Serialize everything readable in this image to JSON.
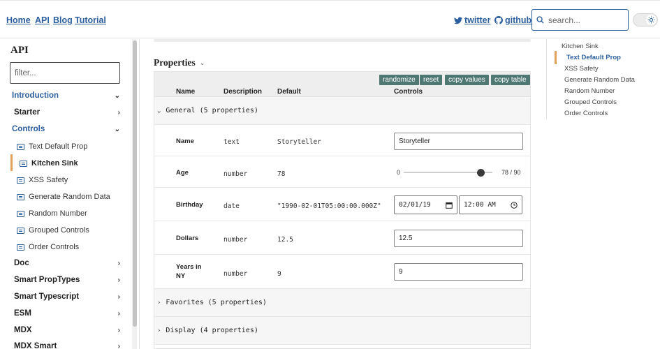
{
  "nav": {
    "home": "Home",
    "api": "API",
    "blog": "Blog",
    "tutorial": "Tutorial",
    "twitter": "twitter",
    "github": "github",
    "search_placeholder": "search..."
  },
  "sidebar": {
    "title": "API",
    "filter_placeholder": "filter...",
    "introduction": "Introduction",
    "starter": "Starter",
    "controls": "Controls",
    "sub": [
      "Text Default Prop",
      "Kitchen Sink",
      "XSS Safety",
      "Generate Random Data",
      "Random Number",
      "Grouped Controls",
      "Order Controls"
    ],
    "doc": "Doc",
    "smart_proptypes": "Smart PropTypes",
    "smart_typescript": "Smart Typescript",
    "esm": "ESM",
    "mdx": "MDX",
    "mdx_smart": "MDX Smart"
  },
  "main": {
    "properties_title": "Properties",
    "buttons": {
      "randomize": "randomize",
      "reset": "reset",
      "copy_values": "copy values",
      "copy_table": "copy table"
    },
    "columns": {
      "name": "Name",
      "description": "Description",
      "default": "Default",
      "controls": "Controls"
    },
    "groups": {
      "general": "General (5 properties)",
      "favorites": "Favorites (5 properties)",
      "display": "Display (4 properties)"
    },
    "rows": {
      "name": {
        "label": "Name",
        "type": "text",
        "default": "Storyteller",
        "value": "Storyteller"
      },
      "age": {
        "label": "Age",
        "type": "number",
        "default": "78",
        "min": "0",
        "readout": "78 / 90",
        "value": 78,
        "max_value": 90
      },
      "birthday": {
        "label": "Birthday",
        "type": "date",
        "default": "\"1990-02-01T05:00:00.000Z\"",
        "date_value": "02/01/19",
        "time_value": "12:00 AM"
      },
      "dollars": {
        "label": "Dollars",
        "type": "number",
        "default": "12.5",
        "value": "12.5"
      },
      "years": {
        "label_line1": "Years in",
        "label_line2": "NY",
        "type": "number",
        "default": "9",
        "value": "9"
      }
    }
  },
  "toc": {
    "items": [
      "Kitchen Sink",
      "Text Default Prop",
      "XSS Safety",
      "Generate Random Data",
      "Random Number",
      "Grouped Controls",
      "Order Controls"
    ]
  },
  "colors": {
    "link": "#2c5f9e",
    "accent": "#e0a15a",
    "button": "#4f7873"
  },
  "icons": {
    "twitter": "twitter-bird-icon",
    "github": "github-octocat-icon",
    "search": "search-icon",
    "theme": "sun-icon",
    "calendar": "calendar-icon",
    "clock": "clock-icon"
  }
}
